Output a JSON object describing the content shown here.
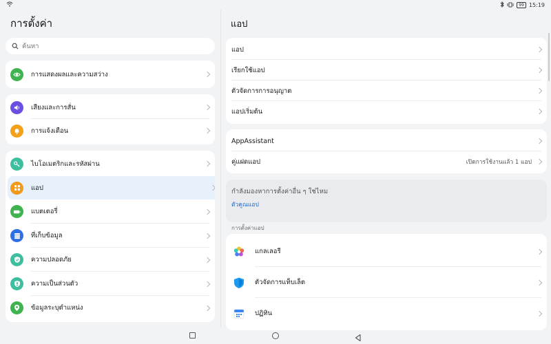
{
  "status": {
    "time": "15:19",
    "battery": "99"
  },
  "left": {
    "title": "การตั้งค่า",
    "search_placeholder": "ค้นหา",
    "groups": [
      [
        {
          "label": "การแสดงผลและความสว่าง",
          "icon": "eye-icon",
          "color": "#3fb34f"
        }
      ],
      [
        {
          "label": "เสียงและการสั่น",
          "icon": "volume-icon",
          "color": "#6a4fe0"
        },
        {
          "label": "การแจ้งเตือน",
          "icon": "bell-icon",
          "color": "#f3a11a"
        }
      ],
      [
        {
          "label": "ไบโอเมตริกและรหัสผ่าน",
          "icon": "key-icon",
          "color": "#3dbf9f"
        },
        {
          "label": "แอป",
          "icon": "apps-grid-icon",
          "color": "#f29a1d",
          "active": true
        },
        {
          "label": "แบตเตอรี่",
          "icon": "battery-icon",
          "color": "#3fb34f"
        },
        {
          "label": "ที่เก็บข้อมูล",
          "icon": "storage-icon",
          "color": "#2f6fe4"
        },
        {
          "label": "ความปลอดภัย",
          "icon": "shield-check-icon",
          "color": "#3dbf9f"
        },
        {
          "label": "ความเป็นส่วนตัว",
          "icon": "privacy-icon",
          "color": "#3dbf9f"
        },
        {
          "label": "ข้อมูลระบุตำแหน่ง",
          "icon": "location-pin-icon",
          "color": "#3fb34f"
        }
      ]
    ]
  },
  "right": {
    "title": "แอป",
    "group1": [
      "แอป",
      "เรียกใช้แอป",
      "ตัวจัดการการอนุญาต",
      "แอปเริ่มต้น"
    ],
    "group2": [
      {
        "label": "AppAssistant",
        "value": ""
      },
      {
        "label": "คู่แฝดแอป",
        "value": "เปิดการใช้งานแล้ว 1 แอป"
      }
    ],
    "suggest_question": "กำลังมองหาการตั้งค่าอื่น ๆ ใช่ไหม",
    "suggest_link": "ตัวคูณแอป",
    "section_label": "การตั้งค่าแอป",
    "app_settings": [
      {
        "label": "แกลเลอรี",
        "icon": "gallery-flower-icon"
      },
      {
        "label": "ตัวจัดการแท็บเล็ต",
        "icon": "tablet-manager-shield-icon"
      },
      {
        "label": "ปฏิทิน",
        "icon": "calendar-icon"
      }
    ]
  }
}
